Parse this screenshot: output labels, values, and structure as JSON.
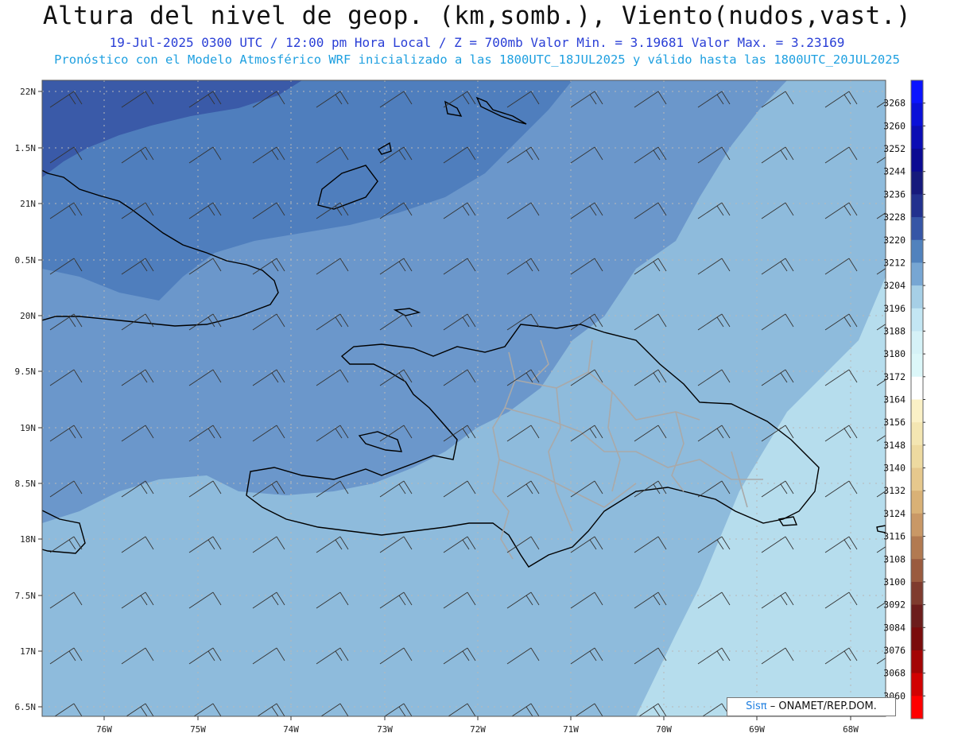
{
  "header": {
    "title": "Altura del nivel de geop. (km,somb.), Viento(nudos,vast.)",
    "subtitle": "19-Jul-2025  0300 UTC / 12:00 pm Hora Local / Z = 700mb   Valor Min. = 3.19681  Valor Max. = 3.23169",
    "model_line": "Pronóstico con el Modelo Atmosférico WRF inicializado a las 1800UTC_18JUL2025 y válido hasta las  1800UTC_20JUL2025"
  },
  "axes": {
    "lat_labels": [
      "22N",
      "1.5N",
      "21N",
      "0.5N",
      "20N",
      "9.5N",
      "19N",
      "8.5N",
      "18N",
      "7.5N",
      "17N",
      "6.5N"
    ],
    "lon_labels": [
      "76W",
      "75W",
      "74W",
      "73W",
      "72W",
      "71W",
      "70W",
      "69W",
      "68W"
    ]
  },
  "colorbar": {
    "labels": [
      "3268",
      "3260",
      "3252",
      "3244",
      "3236",
      "3228",
      "3220",
      "3212",
      "3204",
      "3196",
      "3188",
      "3180",
      "3172",
      "3164",
      "3156",
      "3148",
      "3140",
      "3132",
      "3124",
      "3116",
      "3108",
      "3100",
      "3092",
      "3084",
      "3076",
      "3068",
      "3060"
    ],
    "colors": [
      "#0b14ff",
      "#0a10d8",
      "#0b0db4",
      "#0b0a92",
      "#161a7c",
      "#22318e",
      "#3656a6",
      "#5182bd",
      "#77a6d3",
      "#a6cfe6",
      "#c3e6f3",
      "#d5f2f7",
      "#dcf7f9",
      "#ffffff",
      "#fbf1c6",
      "#f4e6b2",
      "#eedaa0",
      "#e6c88d",
      "#d9b176",
      "#c99866",
      "#b27a51",
      "#9a5b3f",
      "#7f3b2e",
      "#6c1d1c",
      "#7a0c0c",
      "#a30505",
      "#d10202",
      "#ff0000"
    ]
  },
  "legend_colors": {
    "deep": "#3a5aa8",
    "mid": "#4f7ebd",
    "main": "#6b97cb",
    "light": "#8ebbdc",
    "pale": "#b6dded"
  },
  "credit": {
    "brand": "Sisπ",
    "text": "– ONAMET/REP.DOM."
  }
}
